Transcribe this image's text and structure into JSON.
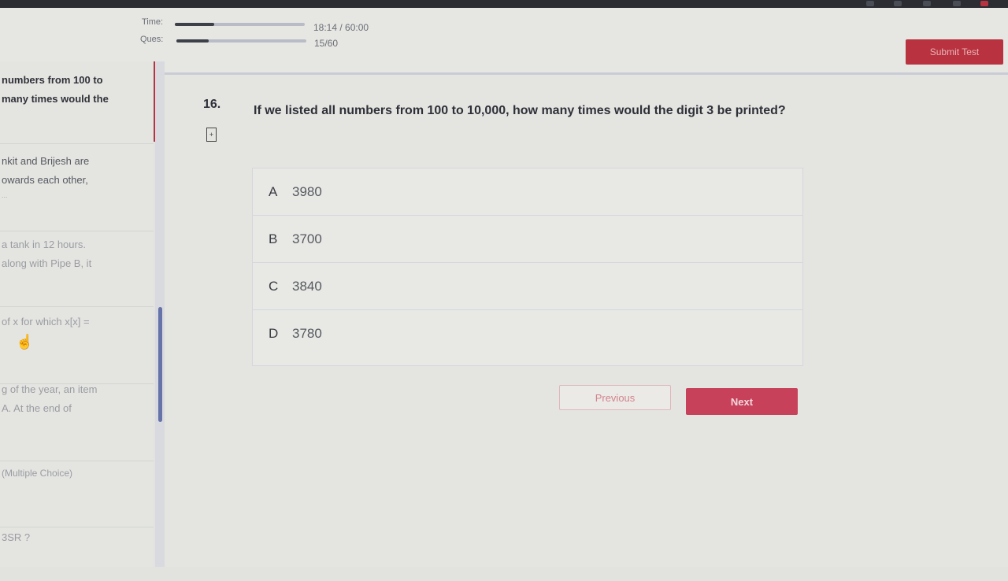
{
  "header": {
    "time_label": "Time:",
    "time_value": "18:14 / 60:00",
    "time_progress": 0.3,
    "ques_label": "Ques:",
    "ques_value": "15/60",
    "ques_progress": 0.25,
    "submit_label": "Submit Test"
  },
  "sidebar": {
    "items": [
      {
        "lines": [
          "numbers from 100 to",
          "many times would the"
        ]
      },
      {
        "lines": [
          "nkit and Brijesh are",
          "owards each other,",
          "..."
        ]
      },
      {
        "lines": [
          "a tank in 12 hours.",
          "along with Pipe B, it"
        ]
      },
      {
        "lines": [
          "of x for which x[x] ="
        ]
      },
      {
        "lines": [
          "g of the year, an item",
          "A. At the end of"
        ]
      },
      {
        "lines": [
          "(Multiple Choice)"
        ]
      },
      {
        "lines": [
          "3SR ?"
        ]
      }
    ]
  },
  "question": {
    "number": "16.",
    "text": "If we listed all numbers from 100 to 10,000, how many times would the digit 3 be printed?",
    "options": [
      {
        "letter": "A",
        "text": "3980"
      },
      {
        "letter": "B",
        "text": "3700"
      },
      {
        "letter": "C",
        "text": "3840"
      },
      {
        "letter": "D",
        "text": "3780"
      }
    ]
  },
  "nav": {
    "previous_label": "Previous",
    "next_label": "Next"
  },
  "colors": {
    "accent": "#c7415a",
    "submit": "#b8333f",
    "scroll_thumb": "#6673a8"
  }
}
